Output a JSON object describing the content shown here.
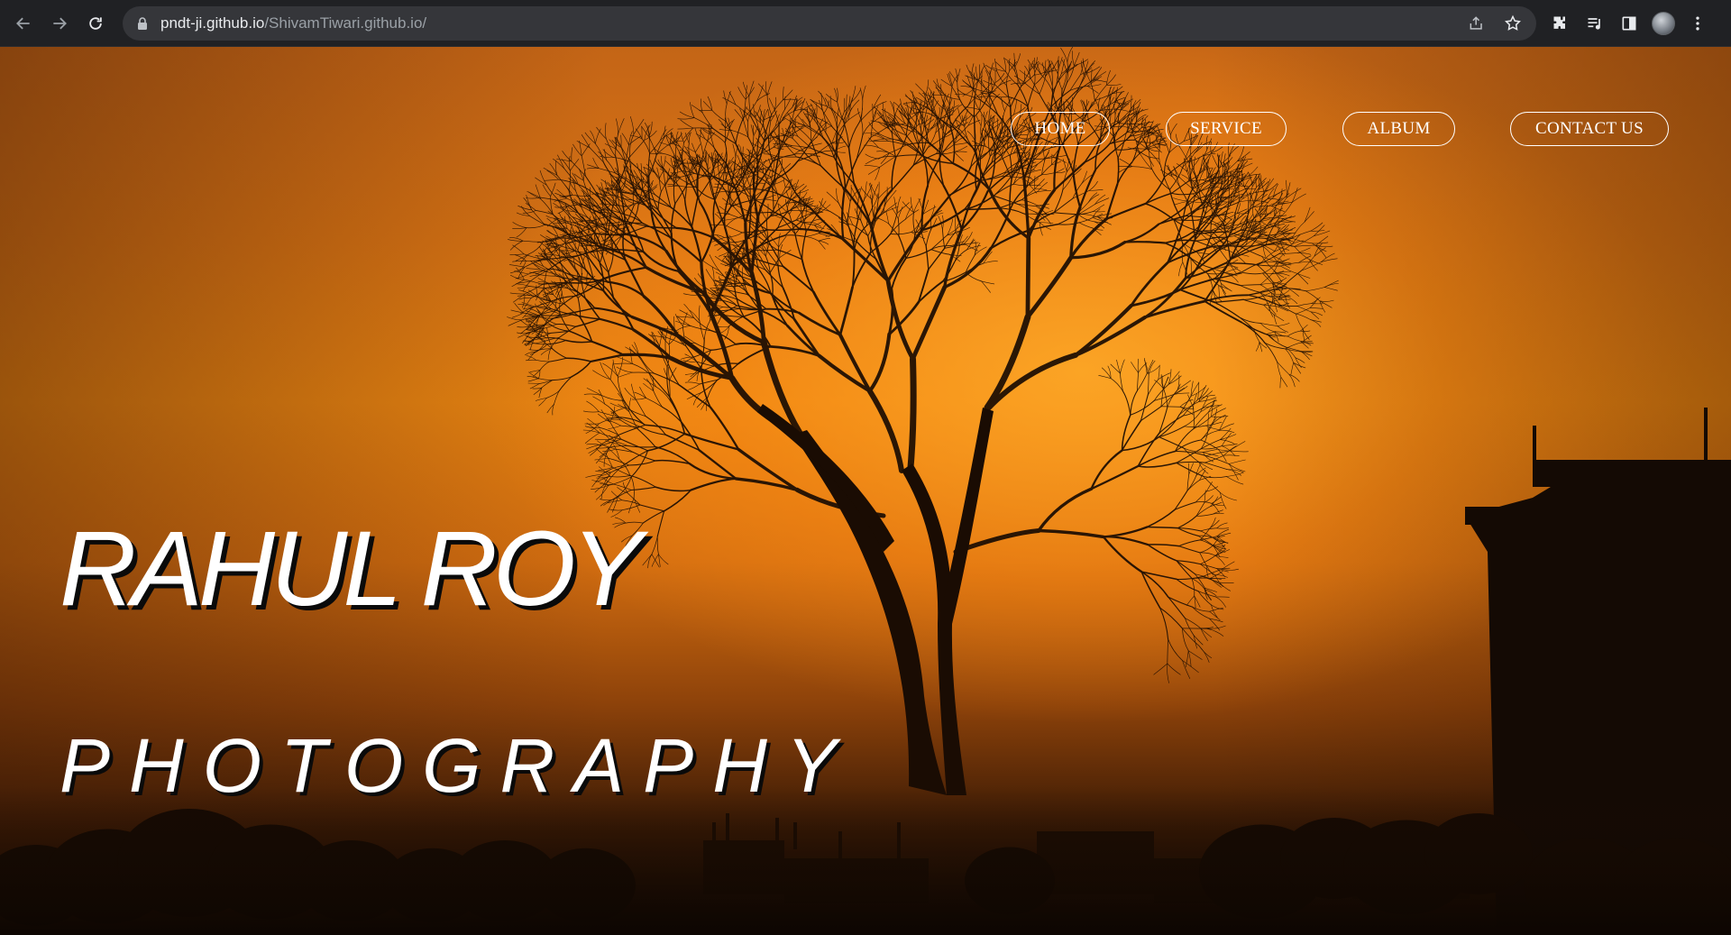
{
  "browser": {
    "url_host": "pndt-ji.github.io",
    "url_path": "/ShivamTiwari.github.io/"
  },
  "nav": {
    "items": [
      {
        "label": "HOME"
      },
      {
        "label": "SERVICE"
      },
      {
        "label": "ALBUM"
      },
      {
        "label": "CONTACT US"
      }
    ]
  },
  "hero": {
    "title": "RAHUL ROY",
    "subtitle": "PHOTOGRAPHY"
  },
  "colors": {
    "sky_orange": "#e98512",
    "silhouette": "#1a0c03",
    "text": "#ffffff"
  }
}
